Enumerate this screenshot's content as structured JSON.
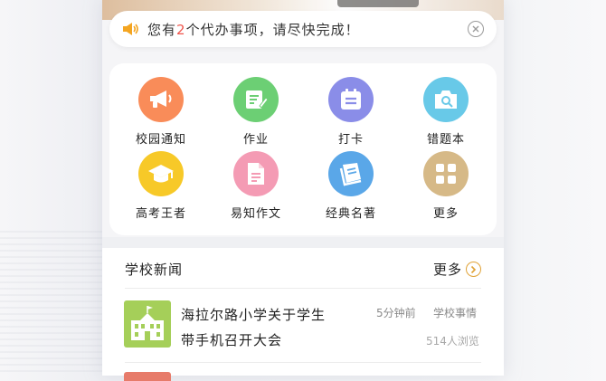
{
  "notice": {
    "prefix": "您有",
    "count": "2",
    "suffix": "个代办事项，请尽快完成！"
  },
  "grid": {
    "items": [
      {
        "label": "校园通知",
        "icon": "megaphone-icon",
        "color": "#f98c59"
      },
      {
        "label": "作业",
        "icon": "edit-note-icon",
        "color": "#6ccf74"
      },
      {
        "label": "打卡",
        "icon": "calendar-icon",
        "color": "#8a8de8"
      },
      {
        "label": "错题本",
        "icon": "camera-icon",
        "color": "#68c9e8"
      },
      {
        "label": "高考王者",
        "icon": "graduation-cap-icon",
        "color": "#f7c928"
      },
      {
        "label": "易知作文",
        "icon": "document-icon",
        "color": "#f49bb4"
      },
      {
        "label": "经典名著",
        "icon": "book-icon",
        "color": "#5aa7e8"
      },
      {
        "label": "更多",
        "icon": "grid-icon",
        "color": "#d6b987"
      }
    ]
  },
  "news": {
    "section_title": "学校新闻",
    "more_label": "更多",
    "items": [
      {
        "title": "海拉尔路小学关于学生带手机召开大会",
        "time": "5分钟前",
        "category": "学校事情",
        "views": "514人浏览",
        "thumb_color": "#a5cf59"
      }
    ]
  },
  "colors": {
    "accent_red": "#f0554c",
    "more_arrow": "#e0a236"
  }
}
